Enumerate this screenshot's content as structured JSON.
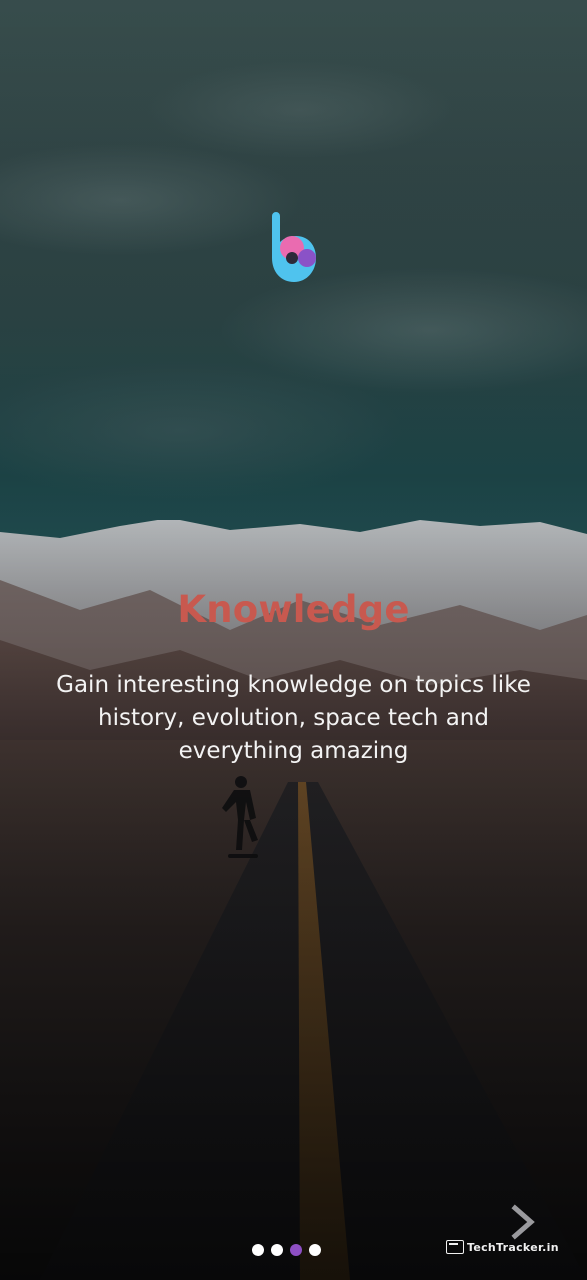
{
  "onboarding": {
    "title": "Knowledge",
    "description": "Gain interesting knowledge on topics like history, evolution, space tech and everything amazing",
    "page_indicator": {
      "total": 4,
      "current": 3
    },
    "next_icon": "chevron-right-icon",
    "logo_icon": "app-logo-b"
  },
  "watermark": {
    "text": "TechTracker.in"
  },
  "colors": {
    "title": "#c8594f",
    "description": "#f3f3f3",
    "dot_active": "#8d4fc4",
    "dot_inactive": "#ffffff",
    "logo_blue": "#4fc3ee",
    "logo_pink": "#ea6bb0",
    "logo_purple": "#8a52c7"
  }
}
